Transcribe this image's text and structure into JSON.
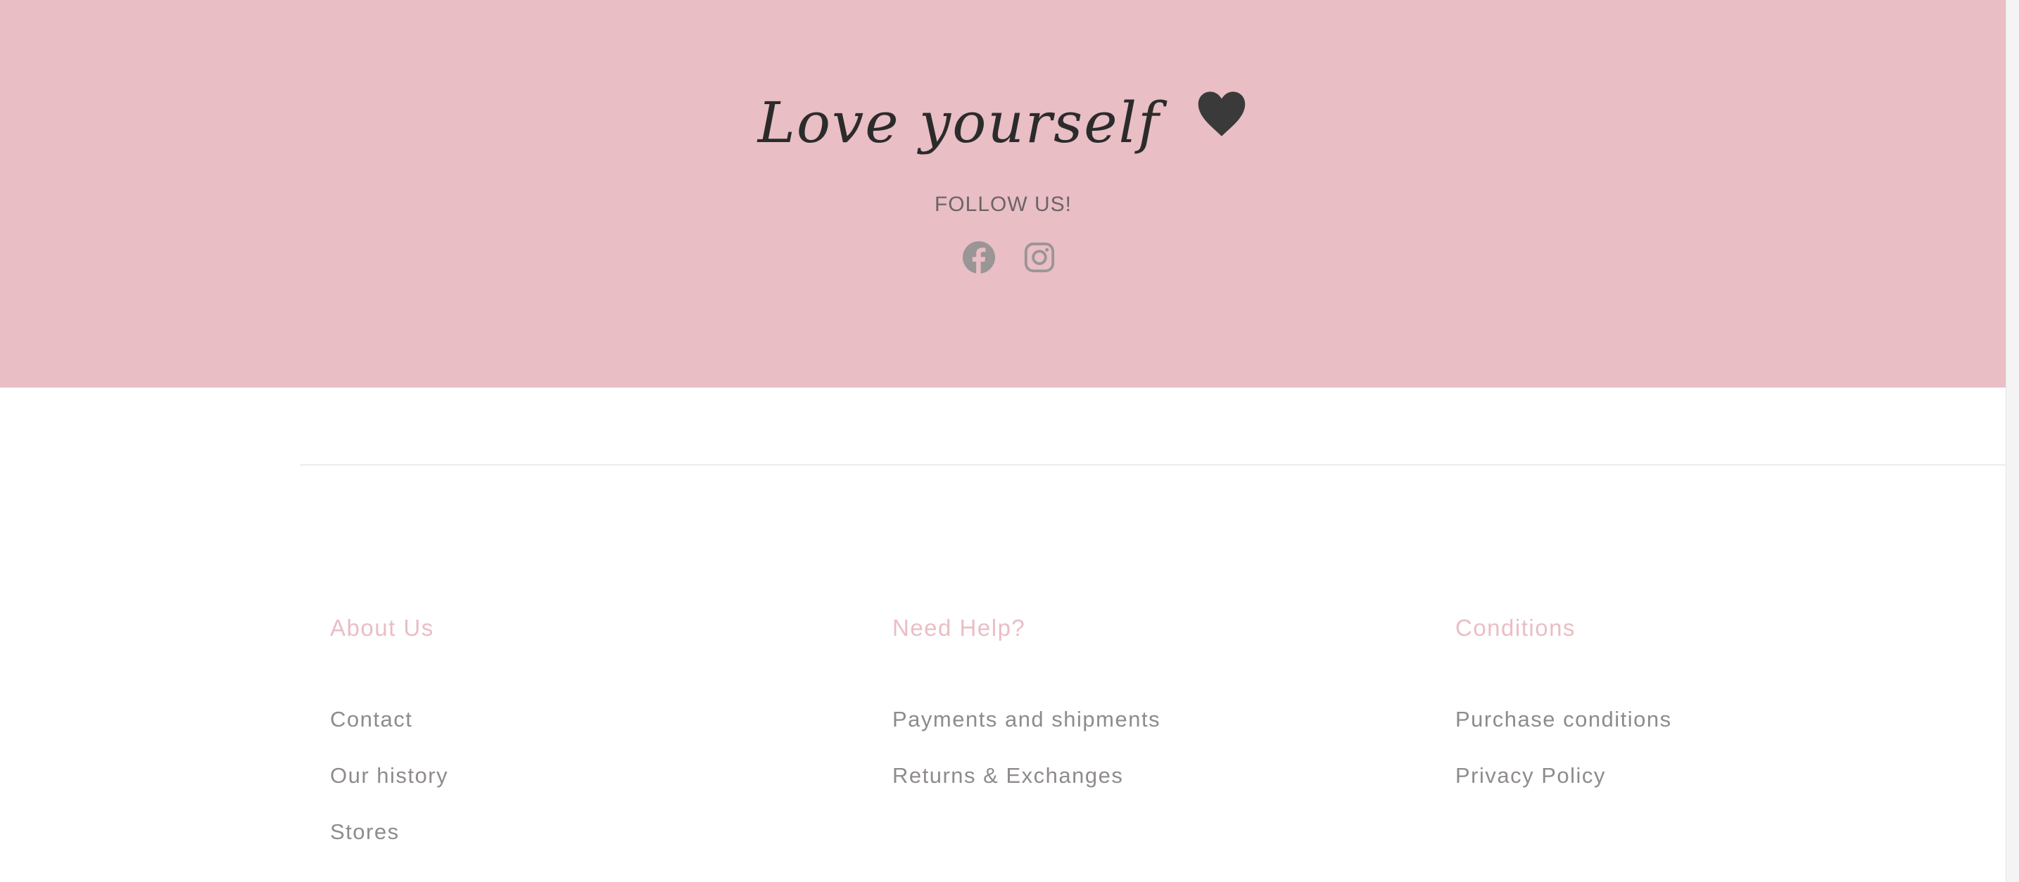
{
  "hero": {
    "title": "Love yourself",
    "heart_icon": "heart-icon",
    "follow_label": "FOLLOW US!",
    "social": [
      {
        "name": "facebook-icon",
        "label": "Facebook"
      },
      {
        "name": "instagram-icon",
        "label": "Instagram"
      }
    ]
  },
  "footer": {
    "columns": [
      {
        "heading": "About Us",
        "links": [
          "Contact",
          "Our history",
          "Stores"
        ]
      },
      {
        "heading": "Need Help?",
        "links": [
          "Payments and shipments",
          "Returns & Exchanges"
        ]
      },
      {
        "heading": "Conditions",
        "links": [
          "Purchase conditions",
          "Privacy Policy"
        ]
      }
    ]
  },
  "colors": {
    "hero_background": "#e9bec5",
    "heading_pink": "#e9bec5",
    "link_gray": "#8f8b8d",
    "social_icon_gray": "#9a9597",
    "title_dark": "#2b2b2b"
  }
}
